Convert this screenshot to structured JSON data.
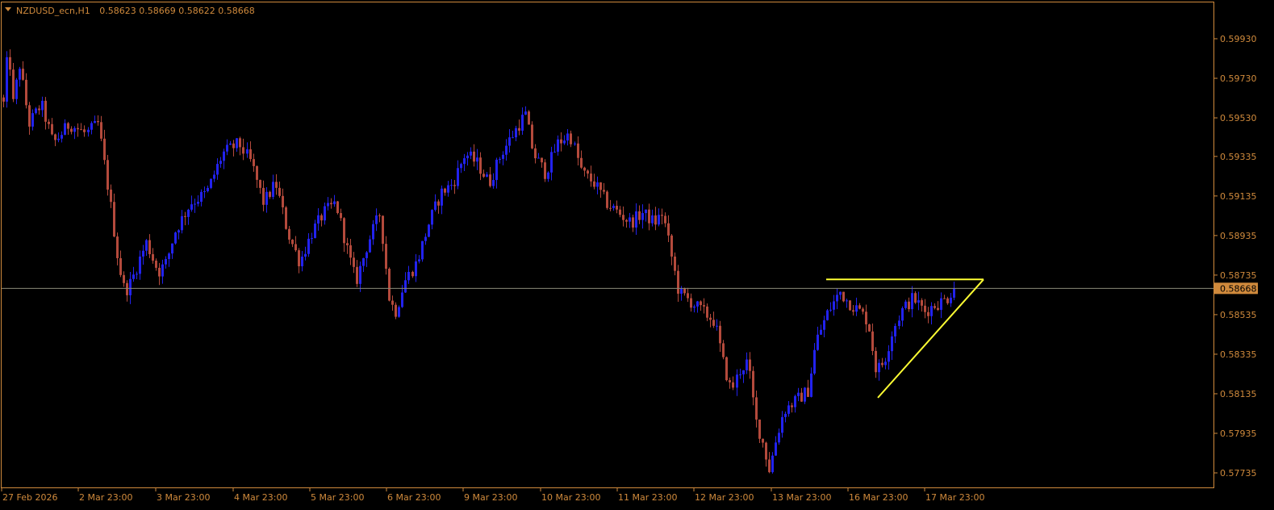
{
  "header": {
    "symbol": "NZDUSD_ecn,H1",
    "ohlc": "0.58623 0.58669 0.58622 0.58668"
  },
  "colors": {
    "background": "#000000",
    "frame": "#d08a3c",
    "text": "#d08a3c",
    "bull_candle": "#2222ee",
    "bear_candle": "#b44a3c",
    "price_line": "#8a8a78",
    "price_label_bg": "#d08a3c",
    "pattern_line": "#ffff33"
  },
  "chart_data": {
    "type": "candlestick",
    "symbol": "NZDUSD_ecn",
    "timeframe": "H1",
    "ylim": [
      0.5768,
      0.6
    ],
    "y_ticks": [
      "0.59930",
      "0.59730",
      "0.59530",
      "0.59335",
      "0.59135",
      "0.58935",
      "0.58735",
      "0.58535",
      "0.58335",
      "0.58135",
      "0.57935",
      "0.57735"
    ],
    "x_ticks": [
      "27 Feb 2026",
      "2 Mar 23:00",
      "3 Mar 23:00",
      "4 Mar 23:00",
      "5 Mar 23:00",
      "6 Mar 23:00",
      "9 Mar 23:00",
      "10 Mar 23:00",
      "11 Mar 23:00",
      "12 Mar 23:00",
      "13 Mar 23:00",
      "16 Mar 23:00",
      "17 Mar 23:00"
    ],
    "current_price": "0.58668",
    "price_path": [
      [
        0,
        0.599
      ],
      [
        6,
        0.595
      ],
      [
        14,
        0.599
      ],
      [
        20,
        0.596
      ],
      [
        28,
        0.598
      ],
      [
        40,
        0.595
      ],
      [
        55,
        0.596
      ],
      [
        70,
        0.594
      ],
      [
        90,
        0.595
      ],
      [
        110,
        0.5945
      ],
      [
        125,
        0.595
      ],
      [
        140,
        0.591
      ],
      [
        150,
        0.588
      ],
      [
        158,
        0.5865
      ],
      [
        166,
        0.587
      ],
      [
        175,
        0.588
      ],
      [
        185,
        0.589
      ],
      [
        200,
        0.5875
      ],
      [
        210,
        0.588
      ],
      [
        220,
        0.5895
      ],
      [
        240,
        0.591
      ],
      [
        260,
        0.5915
      ],
      [
        280,
        0.5935
      ],
      [
        300,
        0.594
      ],
      [
        315,
        0.593
      ],
      [
        330,
        0.591
      ],
      [
        345,
        0.592
      ],
      [
        360,
        0.5895
      ],
      [
        375,
        0.588
      ],
      [
        390,
        0.5895
      ],
      [
        405,
        0.5905
      ],
      [
        420,
        0.591
      ],
      [
        435,
        0.5885
      ],
      [
        445,
        0.587
      ],
      [
        460,
        0.589
      ],
      [
        475,
        0.5905
      ],
      [
        487,
        0.586
      ],
      [
        495,
        0.5855
      ],
      [
        505,
        0.587
      ],
      [
        520,
        0.588
      ],
      [
        535,
        0.59
      ],
      [
        550,
        0.5915
      ],
      [
        565,
        0.592
      ],
      [
        580,
        0.5935
      ],
      [
        595,
        0.593
      ],
      [
        610,
        0.592
      ],
      [
        625,
        0.5935
      ],
      [
        640,
        0.5945
      ],
      [
        655,
        0.5955
      ],
      [
        665,
        0.5935
      ],
      [
        680,
        0.5925
      ],
      [
        695,
        0.594
      ],
      [
        710,
        0.5945
      ],
      [
        725,
        0.5925
      ],
      [
        740,
        0.592
      ],
      [
        755,
        0.591
      ],
      [
        770,
        0.5905
      ],
      [
        785,
        0.59
      ],
      [
        800,
        0.5905
      ],
      [
        815,
        0.59
      ],
      [
        825,
        0.5905
      ],
      [
        835,
        0.5885
      ],
      [
        845,
        0.5865
      ],
      [
        860,
        0.586
      ],
      [
        875,
        0.5855
      ],
      [
        890,
        0.585
      ],
      [
        900,
        0.583
      ],
      [
        910,
        0.5815
      ],
      [
        920,
        0.5825
      ],
      [
        930,
        0.583
      ],
      [
        940,
        0.58
      ],
      [
        948,
        0.579
      ],
      [
        957,
        0.5775
      ],
      [
        965,
        0.579
      ],
      [
        975,
        0.5805
      ],
      [
        990,
        0.581
      ],
      [
        1005,
        0.5815
      ],
      [
        1015,
        0.584
      ],
      [
        1030,
        0.5855
      ],
      [
        1045,
        0.5865
      ],
      [
        1055,
        0.586
      ],
      [
        1070,
        0.5855
      ],
      [
        1080,
        0.585
      ],
      [
        1090,
        0.5825
      ],
      [
        1100,
        0.583
      ],
      [
        1110,
        0.5845
      ],
      [
        1120,
        0.5855
      ],
      [
        1135,
        0.5862
      ],
      [
        1150,
        0.5855
      ],
      [
        1160,
        0.5858
      ],
      [
        1170,
        0.586
      ],
      [
        1178,
        0.5862
      ],
      [
        1185,
        0.5867
      ]
    ]
  }
}
